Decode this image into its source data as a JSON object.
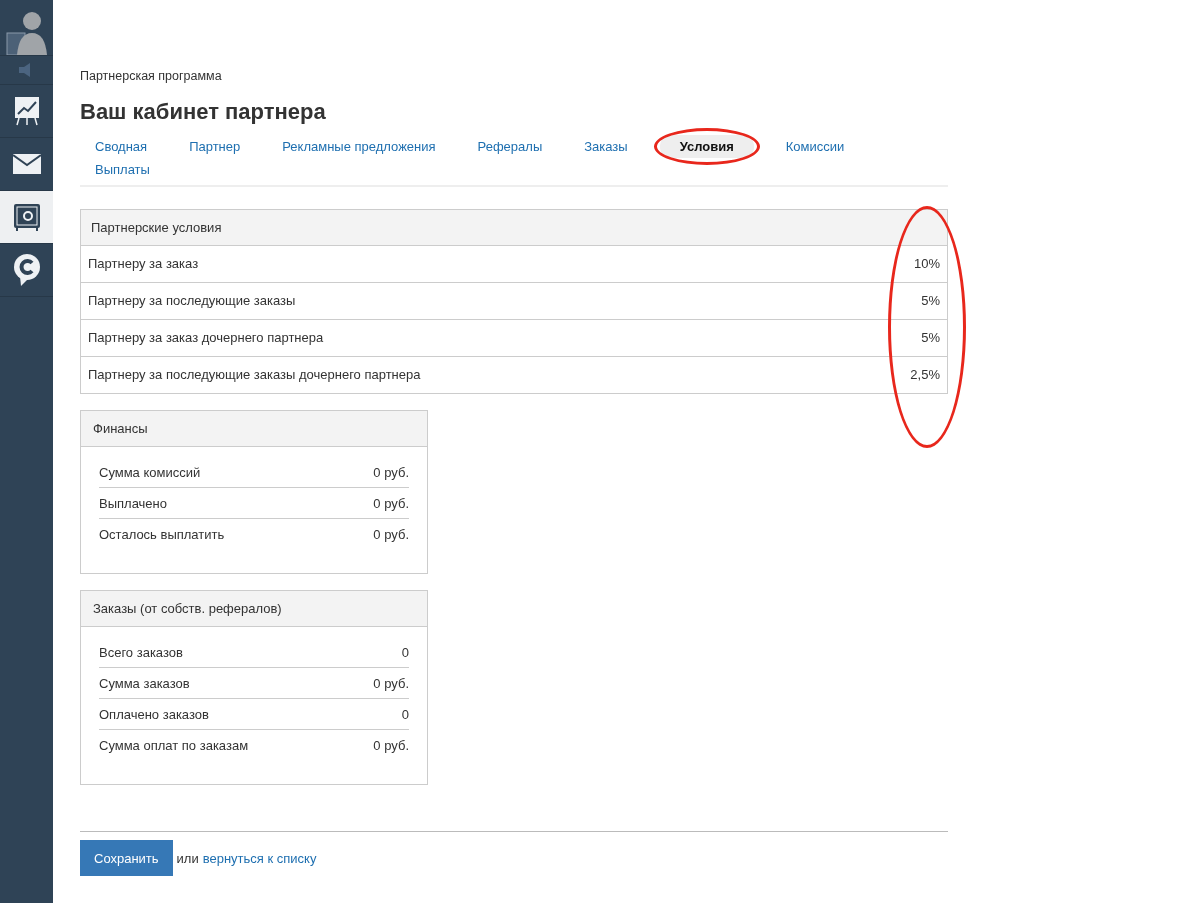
{
  "sidebar": {
    "items": [
      {
        "kind": "avatar",
        "selected": false
      },
      {
        "kind": "speaker",
        "selected": false
      },
      {
        "kind": "chart",
        "selected": false
      },
      {
        "kind": "mail",
        "selected": false
      },
      {
        "kind": "safe",
        "selected": true
      },
      {
        "kind": "chat",
        "selected": false
      }
    ]
  },
  "breadcrumb": "Партнерская программа",
  "title": "Ваш кабинет партнера",
  "tabs": [
    {
      "label": "Сводная",
      "selected": false,
      "circled": false
    },
    {
      "label": "Партнер",
      "selected": false,
      "circled": false
    },
    {
      "label": "Рекламные предложения",
      "selected": false,
      "circled": false
    },
    {
      "label": "Рефералы",
      "selected": false,
      "circled": false
    },
    {
      "label": "Заказы",
      "selected": false,
      "circled": false
    },
    {
      "label": "Условия",
      "selected": true,
      "circled": true
    },
    {
      "label": "Комиссии",
      "selected": false,
      "circled": false
    },
    {
      "label": "Выплаты",
      "selected": false,
      "circled": false
    }
  ],
  "conditions": {
    "title": "Партнерские условия",
    "values_circled": true,
    "rows": [
      {
        "label": "Партнеру за заказ",
        "value": "10%"
      },
      {
        "label": "Партнеру за последующие заказы",
        "value": "5%"
      },
      {
        "label": "Партнеру за заказ дочернего партнера",
        "value": "5%"
      },
      {
        "label": "Партнеру за последующие заказы дочернего партнера",
        "value": "2,5%"
      }
    ]
  },
  "panels": [
    {
      "title": "Финансы",
      "rows": [
        {
          "label": "Сумма комиссий",
          "value": "0 руб."
        },
        {
          "label": "Выплачено",
          "value": "0 руб."
        },
        {
          "label": "Осталось выплатить",
          "value": "0 руб."
        }
      ]
    },
    {
      "title": "Заказы (от собств. рефералов)",
      "rows": [
        {
          "label": "Всего заказов",
          "value": "0"
        },
        {
          "label": "Сумма заказов",
          "value": "0 руб."
        },
        {
          "label": "Оплачено заказов",
          "value": "0"
        },
        {
          "label": "Сумма оплат по заказам",
          "value": "0 руб."
        }
      ]
    }
  ],
  "footer": {
    "save_button": "Сохранить",
    "or_text": "или",
    "back_link": "вернуться к списку"
  }
}
